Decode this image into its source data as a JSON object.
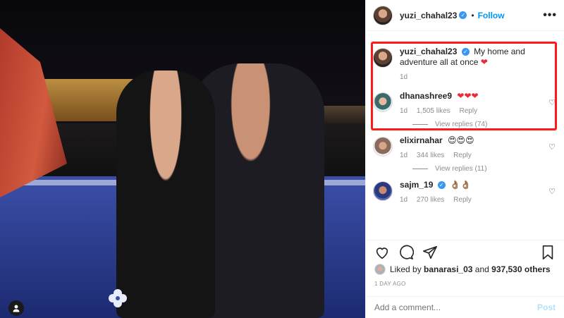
{
  "header": {
    "username": "yuzi_chahal23",
    "separator": "•",
    "follow_label": "Follow",
    "more_label": "•••"
  },
  "comments": [
    {
      "username": "yuzi_chahal23",
      "text": "My home and adventure all at once",
      "emoji": "❤",
      "time": "1d",
      "likes": "",
      "reply_label": ""
    },
    {
      "username": "dhanashree9",
      "text": "",
      "emoji": "❤❤❤",
      "time": "1d",
      "likes": "1,505 likes",
      "reply_label": "Reply",
      "view_replies": "View replies (74)"
    },
    {
      "username": "elixirnahar",
      "text": "",
      "emoji": "😍😍😍",
      "time": "1d",
      "likes": "344 likes",
      "reply_label": "Reply",
      "view_replies": "View replies (11)"
    },
    {
      "username": "sajm_19",
      "text": "",
      "emoji": "👌🏽👌🏽",
      "time": "1d",
      "likes": "270 likes",
      "reply_label": "Reply"
    }
  ],
  "likes": {
    "prefix": "Liked by",
    "user": "banarasi_03",
    "middle": "and",
    "count": "937,530 others"
  },
  "date": "1 DAY AGO",
  "add_comment": {
    "placeholder": "Add a comment...",
    "post_label": "Post"
  },
  "colors": {
    "accent": "#0095f6",
    "highlight": "#ff1a1a",
    "heart": "#ed2939"
  }
}
